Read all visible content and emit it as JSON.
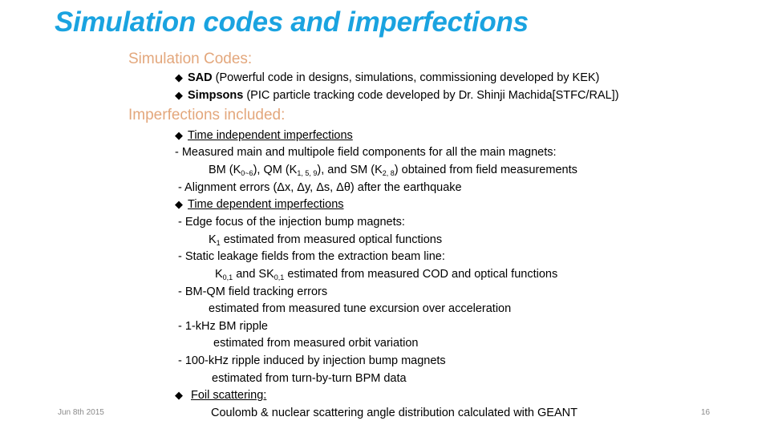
{
  "title": "Simulation codes and imperfections",
  "colors": {
    "title": "#1aa3e0",
    "heading": "#e3a77c"
  },
  "sim_codes": {
    "heading": "Simulation Codes:",
    "items": [
      {
        "name": "SAD",
        "desc": " (Powerful code in designs, simulations, commissioning developed by KEK)"
      },
      {
        "name": "Simpsons",
        "desc": " (PIC particle tracking code developed by Dr. Shinji Machida[STFC/RAL])"
      }
    ]
  },
  "imperfections": {
    "heading": "Imperfections included:",
    "bullet_icon": "diamond-icon",
    "time_independent": {
      "label": "Time independent imperfections",
      "l1": "- Measured main and multipole field components for all the main magnets:",
      "l2": {
        "bm": "BM (K",
        "bm_sub": "0~6",
        "qm": "), QM (K",
        "qm_sub": "1, 5, 9",
        "sm": "), and SM (K",
        "sm_sub": "2, 8",
        "end": ") obtained from field measurements"
      },
      "l3": "- Alignment errors (Δx, Δy, Δs, Δθ) after the earthquake"
    },
    "time_dependent": {
      "label": "Time dependent imperfections",
      "edge_focus": "- Edge focus of the injection bump magnets:",
      "k1": {
        "k": "K",
        "sub": "1",
        "rest": " estimated from measured optical functions"
      },
      "leakage": "- Static leakage fields from the extraction beam line:",
      "k01": {
        "k": "K",
        "sub1": "0,1",
        "mid": " and SK",
        "sub2": "0,1",
        "rest": " estimated from measured COD and optical functions"
      },
      "tracking": "- BM-QM field tracking errors",
      "tracking_detail": "estimated from measured tune excursion over acceleration",
      "ripple1k": "- 1-kHz BM ripple",
      "ripple1k_detail": "estimated from measured orbit variation",
      "ripple100k": "- 100-kHz ripple induced by injection bump magnets",
      "ripple100k_detail": "estimated from turn-by-turn BPM data"
    },
    "foil": {
      "label": "Foil scattering:",
      "detail": "Coulomb & nuclear scattering angle distribution calculated with GEANT"
    }
  },
  "footer": {
    "date": "Jun 8th 2015",
    "page": "16"
  }
}
